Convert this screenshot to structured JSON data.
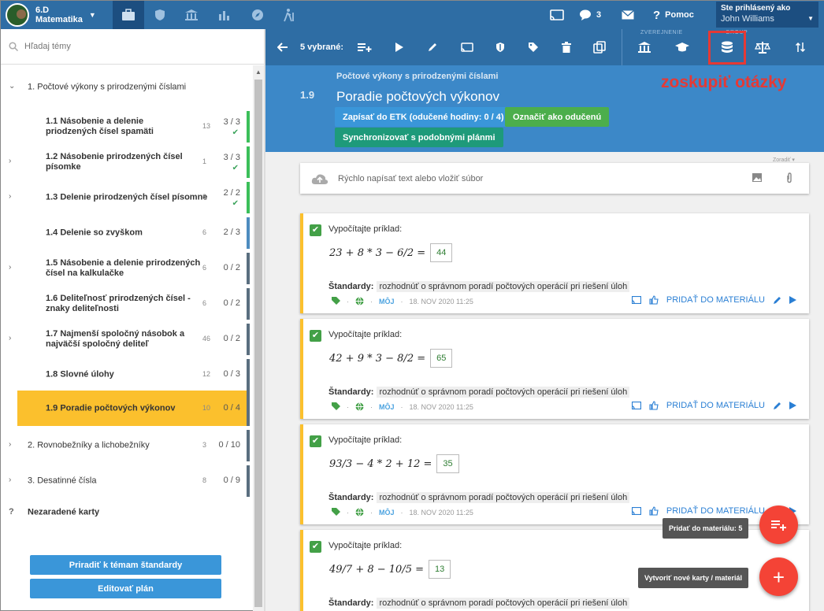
{
  "app": {
    "class_name": "6.D",
    "subject": "Matematika"
  },
  "topnav": {
    "messages_count": "3",
    "help_label": "Pomoc",
    "login_label": "Ste prihlásený ako",
    "user_name": "John Williams"
  },
  "sidebar": {
    "search_placeholder": "Hľadaj témy",
    "topics": [
      {
        "label": "1. Počtové výkony s prirodzenými číslami",
        "count": "",
        "progress": ""
      },
      {
        "label": "1.1  Násobenie a delenie priodzených čísel spamäti",
        "count": "13",
        "progress": "3 / 3"
      },
      {
        "label": "1.2  Násobenie prirodzených čísel písomke",
        "count": "1",
        "progress": "3 / 3"
      },
      {
        "label": "1.3  Delenie prirodzených čísel písomne",
        "count": "8",
        "progress": "2 / 2"
      },
      {
        "label": "1.4  Delenie so zvyškom",
        "count": "6",
        "progress": "2 / 3"
      },
      {
        "label": "1.5  Násobenie a delenie prirodzených čísel na kalkulačke",
        "count": "6",
        "progress": "0 / 2"
      },
      {
        "label": "1.6  Deliteľnosť prirodzených čísel - znaky deliteľnosti",
        "count": "6",
        "progress": "0 / 2"
      },
      {
        "label": "1.7  Najmenší spoločný násobok a najväčší spoločný deliteľ",
        "count": "46",
        "progress": "0 / 2"
      },
      {
        "label": "1.8  Slovné úlohy",
        "count": "12",
        "progress": "0 / 3"
      },
      {
        "label": "1.9  Poradie počtových výkonov",
        "count": "10",
        "progress": "0 / 4"
      },
      {
        "label": "2.  Rovnobežníky a lichobežníky",
        "count": "3",
        "progress": "0 / 10"
      },
      {
        "label": "3.  Desatinné čísla",
        "count": "8",
        "progress": "0 / 9"
      },
      {
        "label": "Nezaradené karty",
        "count": "",
        "progress": ""
      }
    ],
    "assign_button": "Priradiť k témam štandardy",
    "edit_button": "Editovať plán"
  },
  "toolbar": {
    "selected_label": "5 vybrané:",
    "publish_label": "ZVEREJNENIE",
    "group_label": "GROUP",
    "annotation": "zoskupiť otázky"
  },
  "header": {
    "number": "1.9",
    "parent": "Počtové výkony s prirodzenými číslami",
    "title": "Poradie počtových výkonov",
    "btn_etk": "Zapísať do ETK (odučené hodiny: 0 / 4)",
    "btn_taught": "Označiť ako odučenú",
    "btn_sync": "Synchronizovať s podobnými plánmi"
  },
  "quick": {
    "placeholder": "Rýchlo napísať text alebo vložiť súbor",
    "sort_hint": "Zoradiť ▾"
  },
  "cards": [
    {
      "title": "Vypočítajte príklad:",
      "expr": "23 + 8 * 3 − 6/2 =",
      "answer": "44",
      "std_label": "Štandardy:",
      "standard": "rozhodnúť o správnom poradí počtových operácií pri riešení úloh",
      "owner": "MÔJ",
      "date": "18. NOV 2020 11:25",
      "add_label": "PRIDAŤ DO MATERIÁLU"
    },
    {
      "title": "Vypočítajte príklad:",
      "expr": "42 + 9 * 3 − 8/2 =",
      "answer": "65",
      "std_label": "Štandardy:",
      "standard": "rozhodnúť o správnom poradí počtových operácií pri riešení úloh",
      "owner": "MÔJ",
      "date": "18. NOV 2020 11:25",
      "add_label": "PRIDAŤ DO MATERIÁLU"
    },
    {
      "title": "Vypočítajte príklad:",
      "expr": "93/3 − 4 * 2 + 12 =",
      "answer": "35",
      "std_label": "Štandardy:",
      "standard": "rozhodnúť o správnom poradí počtových operácií pri riešení úloh",
      "owner": "MÔJ",
      "date": "18. NOV 2020 11:25",
      "add_label": "PRIDAŤ DO MATERIÁLU"
    },
    {
      "title": "Vypočítajte príklad:",
      "expr": "49/7 + 8 − 10/5 =",
      "answer": "13",
      "std_label": "Štandardy:",
      "standard": "rozhodnúť o správnom poradí počtových operácií pri riešení úloh",
      "owner": "",
      "date": "",
      "add_label": ""
    }
  ],
  "fab": {
    "add_tip": "Pridať do materiálu: 5",
    "new_tip": "Vytvoriť nové karty / materiál"
  },
  "colors": {
    "primary": "#2e6da4",
    "header": "#3c88c8",
    "accent_yellow": "#fbc02d",
    "green": "#43a047",
    "fab": "#f44336",
    "annotation": "#e53935"
  }
}
